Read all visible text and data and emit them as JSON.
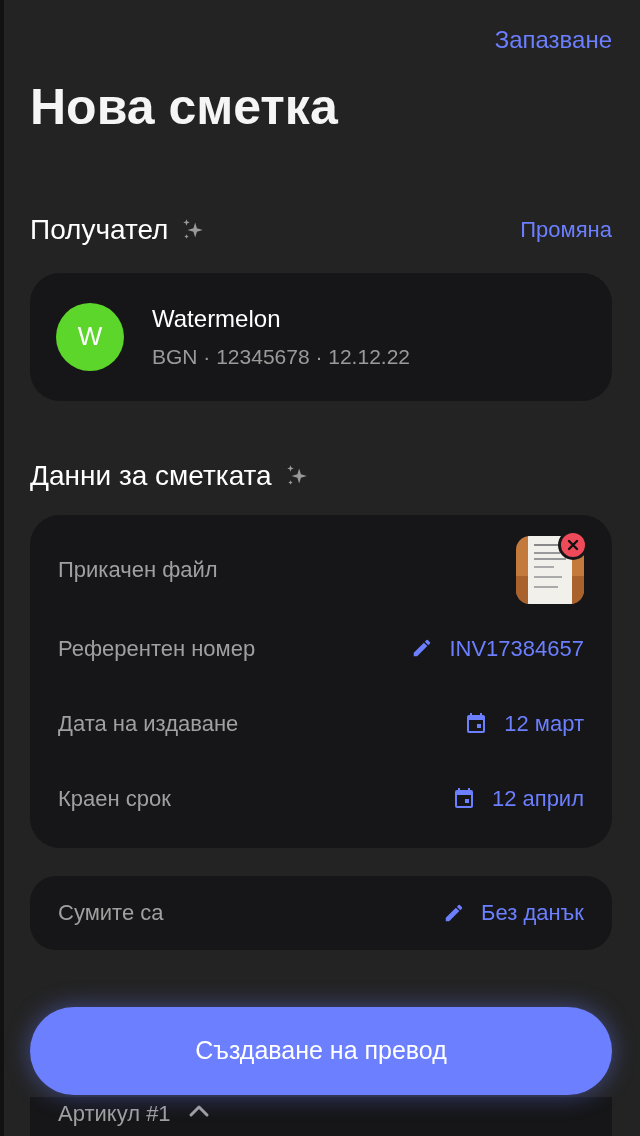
{
  "header": {
    "action": "Запазване",
    "title": "Нова сметка"
  },
  "recipient": {
    "heading": "Получател",
    "action": "Промяна",
    "avatar": {
      "letter": "W",
      "color": "#5cd62a"
    },
    "name": "Watermelon",
    "details": "BGN · 12345678 · 12.12.22"
  },
  "invoice": {
    "heading": "Данни за сметката",
    "rows": [
      {
        "kind": "attachment",
        "label": "Прикачен файл"
      },
      {
        "kind": "edit",
        "label": "Референтен номер",
        "value": "INV17384657"
      },
      {
        "kind": "date",
        "label": "Дата на издаване",
        "value": "12 март"
      },
      {
        "kind": "date",
        "label": "Краен срок",
        "value": "12 април"
      }
    ]
  },
  "amounts": {
    "kind": "edit",
    "label": "Сумите са",
    "value": "Без данък"
  },
  "item": {
    "label": "Артикул #1",
    "expanded": true
  },
  "primary_button": "Създаване на превод"
}
